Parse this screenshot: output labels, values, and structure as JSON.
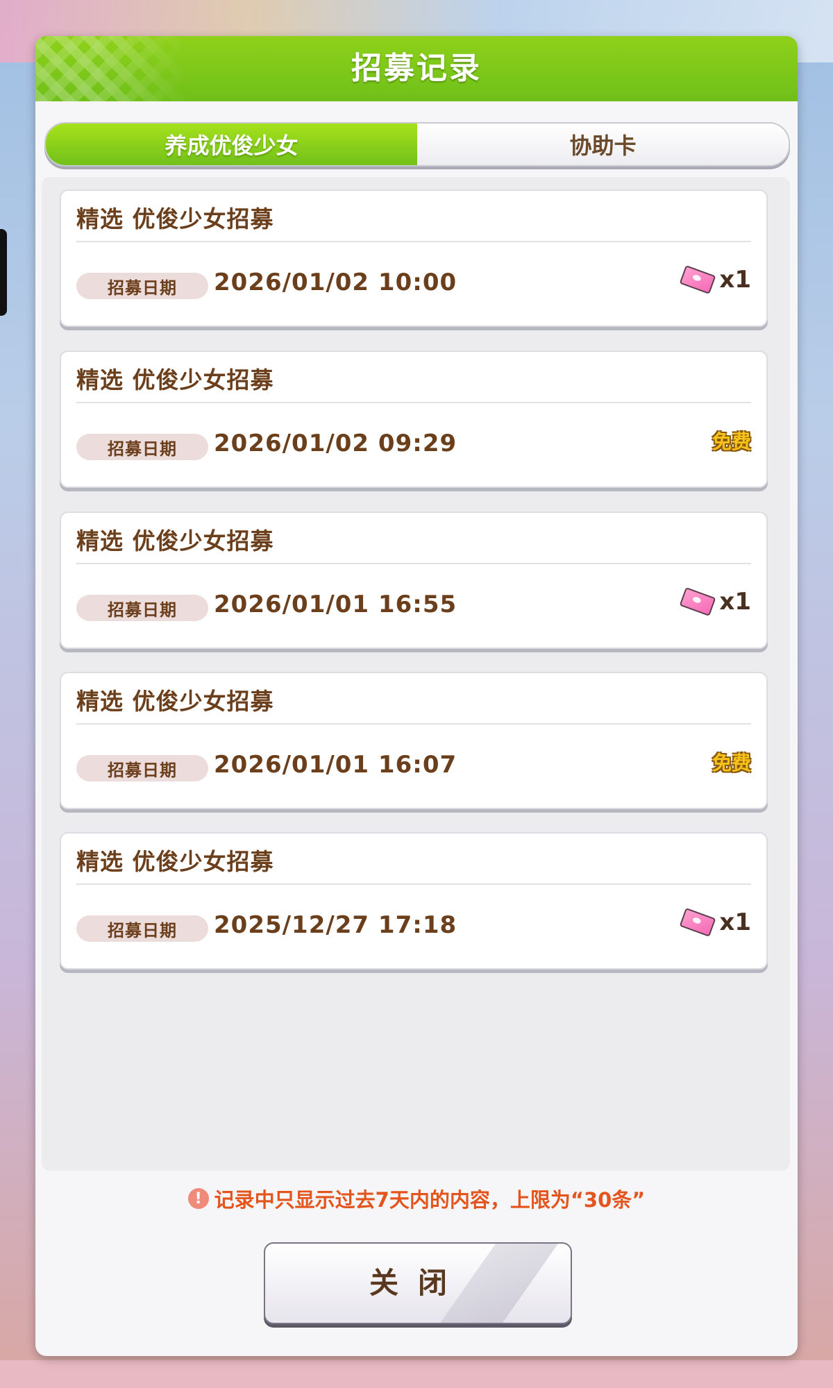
{
  "dialog": {
    "title": "招募记录",
    "tabs": [
      {
        "label": "养成优俊少女",
        "active": true
      },
      {
        "label": "协助卡",
        "active": false
      }
    ],
    "records": [
      {
        "title": "精选  优俊少女招募",
        "date_label": "招募日期",
        "date": "2026/01/02  10:00",
        "cost_type": "ticket",
        "cost_qty": "x1"
      },
      {
        "title": "精选  优俊少女招募",
        "date_label": "招募日期",
        "date": "2026/01/02  09:29",
        "cost_type": "free",
        "cost_text": "免费"
      },
      {
        "title": "精选  优俊少女招募",
        "date_label": "招募日期",
        "date": "2026/01/01  16:55",
        "cost_type": "ticket",
        "cost_qty": "x1"
      },
      {
        "title": "精选  优俊少女招募",
        "date_label": "招募日期",
        "date": "2026/01/01  16:07",
        "cost_type": "free",
        "cost_text": "免费"
      },
      {
        "title": "精选  优俊少女招募",
        "date_label": "招募日期",
        "date": "2025/12/27  17:18",
        "cost_type": "ticket",
        "cost_qty": "x1"
      }
    ],
    "notice": "记录中只显示过去7天内的内容，上限为“30条”",
    "notice_icon": "!",
    "close_label": "关闭"
  },
  "colors": {
    "header_green": "#7dc81a",
    "text_brown": "#6b3f1b",
    "notice_orange": "#e4551d",
    "free_gold": "#f7c31a",
    "ticket_pink": "#f46bb6"
  },
  "icons": {
    "ticket": "gacha-ticket-icon",
    "alert": "alert-circle-icon"
  }
}
